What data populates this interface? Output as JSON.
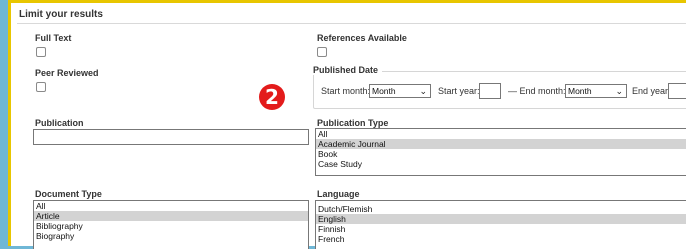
{
  "panel": {
    "title": "Limit your results"
  },
  "filters": {
    "full_text": {
      "label": "Full Text"
    },
    "references_available": {
      "label": "References Available"
    },
    "peer_reviewed": {
      "label": "Peer Reviewed"
    },
    "published_date": {
      "label": "Published Date",
      "start_month_label": "Start month:",
      "start_month_value": "Month",
      "start_year_label": "Start year:",
      "separator": "— End month:",
      "end_month_value": "Month",
      "end_year_label": "End year:"
    },
    "publication": {
      "label": "Publication",
      "value": ""
    },
    "publication_type": {
      "label": "Publication Type",
      "options": [
        "All",
        "Academic Journal",
        "Book",
        "Case Study"
      ],
      "selected": "Academic Journal"
    },
    "document_type": {
      "label": "Document Type",
      "options": [
        "All",
        "Article",
        "Bibliography",
        "Biography"
      ],
      "selected": "Article"
    },
    "language": {
      "label": "Language",
      "options": [
        "Dutch/Flemish",
        "English",
        "Finnish",
        "French"
      ],
      "selected": "English"
    }
  },
  "step_badge": "2",
  "colors": {
    "background": "#6fb7d6",
    "panel_border": "#e8c600",
    "badge": "#e31b1b",
    "selected_option": "#d3d3d3"
  }
}
